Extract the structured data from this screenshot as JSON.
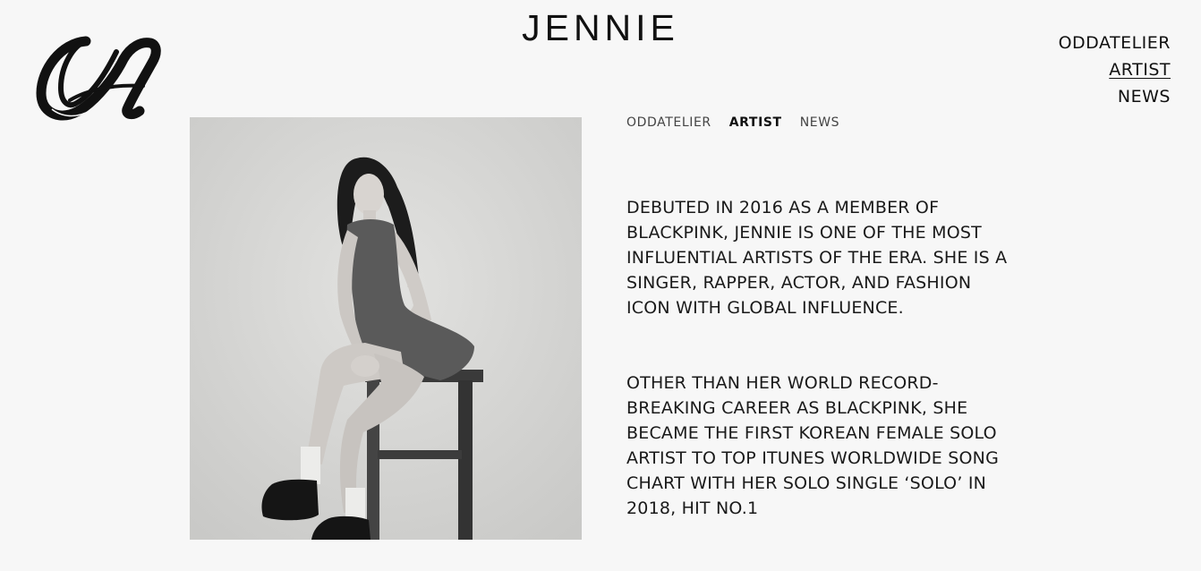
{
  "header": {
    "logo_name": "oddatelier-logo",
    "title": "JENNIE"
  },
  "top_nav": [
    {
      "label": "ODDATELIER",
      "active": false
    },
    {
      "label": "ARTIST",
      "active": true
    },
    {
      "label": "NEWS",
      "active": false
    }
  ],
  "sub_nav": [
    {
      "label": "ODDATELIER",
      "active": false
    },
    {
      "label": "ARTIST",
      "active": true
    },
    {
      "label": "NEWS",
      "active": false
    }
  ],
  "bio": {
    "paragraph_1": "DEBUTED IN 2016 AS A MEMBER OF BLACKPINK, JENNIE IS ONE OF THE MOST INFLUENTIAL ARTISTS OF THE ERA. SHE IS A SINGER, RAPPER, ACTOR, AND FASHION ICON WITH GLOBAL INFLUENCE.",
    "paragraph_2": "OTHER THAN HER WORLD RECORD-BREAKING CAREER AS BLACKPINK, SHE BECAME THE FIRST KOREAN FEMALE SOLO ARTIST TO TOP ITUNES WORLDWIDE SONG CHART WITH HER SOLO SINGLE ‘SOLO’ IN 2018, HIT NO.1"
  },
  "colors": {
    "background": "#f7f7f7",
    "text": "#111111"
  }
}
